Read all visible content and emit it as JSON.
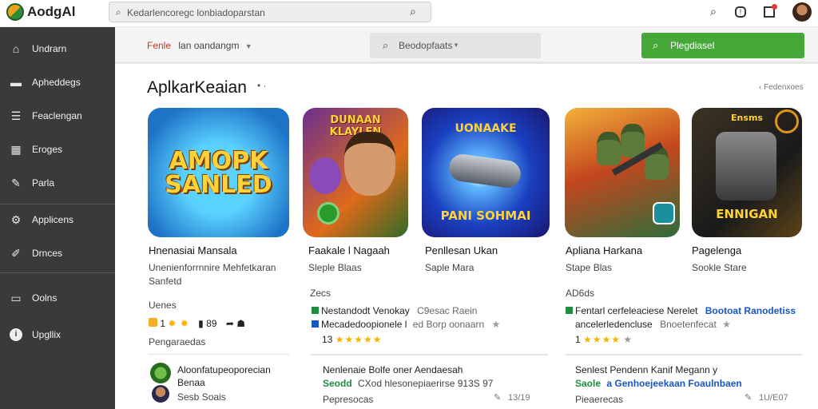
{
  "app": {
    "title": "AodgAl"
  },
  "search": {
    "value": "Kedarlencoregc lonbiadoparstan"
  },
  "sidebar": {
    "items": [
      {
        "label": "Undrarn"
      },
      {
        "label": "Apheddegs"
      },
      {
        "label": "Feaclengan"
      },
      {
        "label": "Eroges"
      },
      {
        "label": "Parla"
      },
      {
        "label": "Applicens"
      },
      {
        "label": "Drnces"
      },
      {
        "label": "Oolns"
      },
      {
        "label": "Upgllix"
      }
    ]
  },
  "subbar": {
    "filter_label": "Fenle",
    "filter_value": "lan oandangm",
    "search_value": "Beodopfaats",
    "go_button": "Plegdiasel"
  },
  "section": {
    "title": "AplkarKeaian",
    "nav": "Fedenxoes"
  },
  "apps": [
    {
      "icon_caption": "AMOPK SANLED",
      "name": "Hnenasiai Mansala",
      "desc1": "Unenienforrnnire Mehfetkaran",
      "desc2": "Sanfetd"
    },
    {
      "icon_caption": "DUNAAN KLAYLEN",
      "name": "Faakale l Nagaah",
      "desc1": "Sleple Blaas",
      "desc2": ""
    },
    {
      "icon_caption": "UONAAKE",
      "icon_caption2": "PANI SOHMAI",
      "name": "Penllesan Ukan",
      "desc1": "Saple Mara",
      "desc2": ""
    },
    {
      "icon_caption": "",
      "name": "Apliana Harkana",
      "desc1": "Stape Blas",
      "desc2": ""
    },
    {
      "icon_caption": "Ensms",
      "icon_caption2": "ENNIGAN",
      "name": "Pagelenga",
      "desc1": "Sookle Stare",
      "desc2": ""
    }
  ],
  "details": {
    "col1": {
      "header": "Uenes",
      "footer": "Pengaraedas",
      "counts": "1",
      "c2": "89"
    },
    "col2": {
      "header": "Zecs",
      "line1_a": "Nestandodt Venokay",
      "line1_b": "C9esac Raein",
      "line2_a": "Mecadedoopionele l",
      "line2_b": "ed Borp oonaarn",
      "rating": "13"
    },
    "col3": {
      "header": "AD6ds",
      "line1_a": "Fentarl cerfeleaciese Nerelet",
      "line1_b": "Bootoat Ranodetiss",
      "line2_a": "ancelerledencluse",
      "line2_b": "Bnoetenfecat",
      "rating": "1"
    }
  },
  "bottom": {
    "col1": {
      "title": "Aloonfatupeoporecian",
      "sub": "Benaa",
      "sub2": "Sesb Soais"
    },
    "col2": {
      "title": "Nenlenaie Bolfe oner Aendaesah",
      "line_a": "Seodd",
      "line_b": "CXod hlesonepiaerirse 913S 97",
      "foot": "Pepresocas",
      "count": "13/19"
    },
    "col3": {
      "title": "Senlest Pendenn Kanif Megann y",
      "line_a": "Saole",
      "line_b": "a Genhoejeekaan Foaulnbaen",
      "foot": "Pieaerecas",
      "count": "1U/E07"
    }
  }
}
